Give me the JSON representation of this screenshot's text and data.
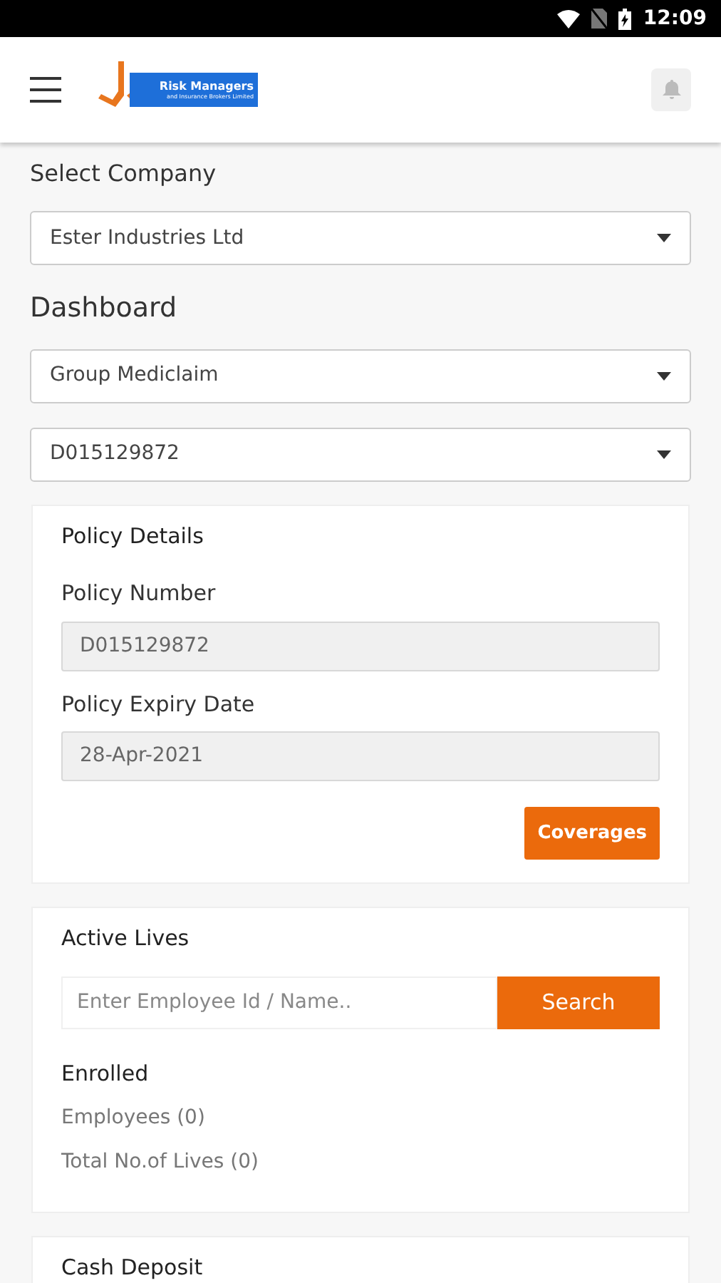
{
  "status_bar": {
    "time": "12:09"
  },
  "app_bar": {
    "logo": {
      "title": "Risk Managers",
      "subtitle": "and Insurance Brokers Limited"
    }
  },
  "company": {
    "label": "Select Company",
    "value": "Ester Industries Ltd"
  },
  "dashboard": {
    "title": "Dashboard",
    "selects": [
      "Group Mediclaim",
      "D015129872"
    ]
  },
  "policy_details": {
    "title": "Policy Details",
    "fields": [
      {
        "label": "Policy Number",
        "value": "D015129872"
      },
      {
        "label": "Policy Expiry Date",
        "value": "28-Apr-2021"
      }
    ],
    "button": "Coverages"
  },
  "active_lives": {
    "title": "Active Lives",
    "search": {
      "placeholder": "Enter Employee Id / Name..",
      "button": "Search"
    },
    "enrolled": {
      "title": "Enrolled",
      "items": [
        "Employees (0)",
        "Total No.of Lives (0)"
      ]
    }
  },
  "cash_deposit": {
    "title": "Cash Deposit"
  }
}
